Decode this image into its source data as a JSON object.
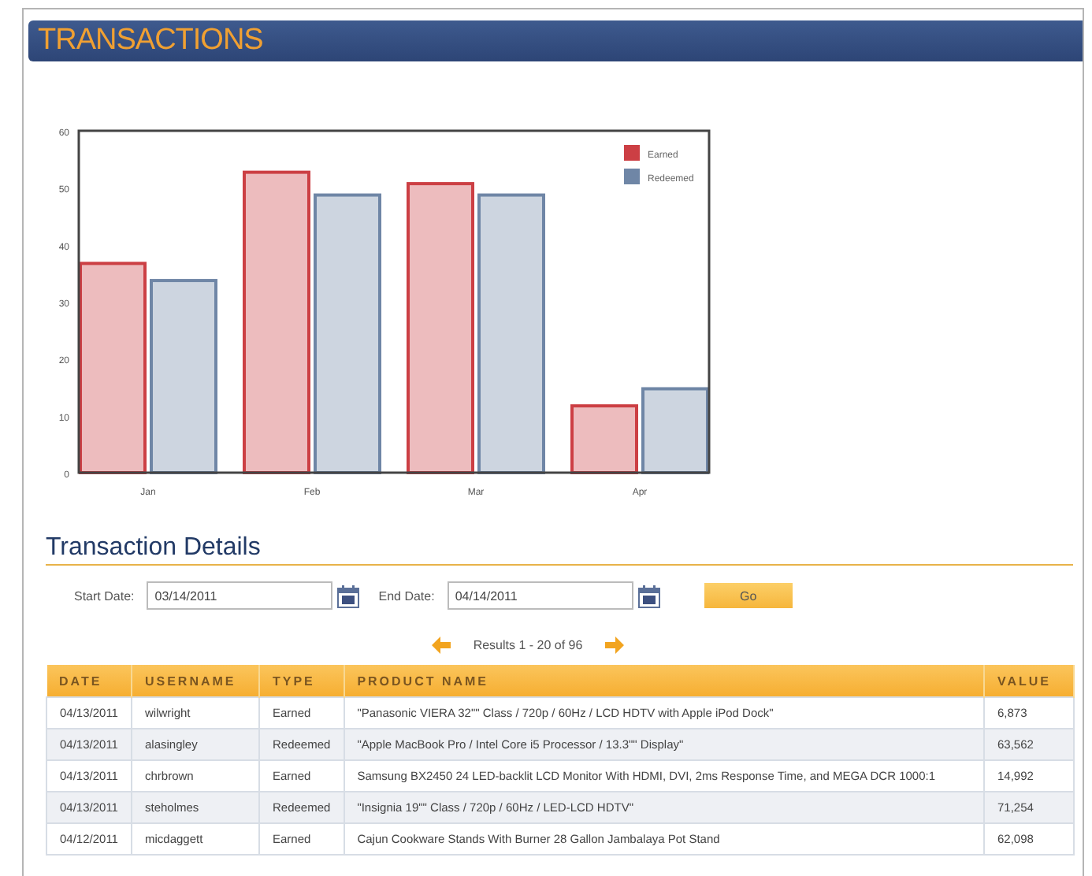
{
  "header": {
    "title": "TRANSACTIONS"
  },
  "chart": {
    "chart_data": {
      "type": "bar",
      "legend": true,
      "categories": [
        "Jan",
        "Feb",
        "Mar",
        "Apr"
      ],
      "ylim": [
        0,
        60
      ],
      "yticks": [
        0,
        10,
        20,
        30,
        40,
        50,
        60
      ],
      "series": [
        {
          "name": "Earned",
          "color": "#cc3f44",
          "values": [
            37,
            53,
            51,
            12
          ]
        },
        {
          "name": "Redeemed",
          "color": "#6f86a6",
          "values": [
            34,
            49,
            49,
            15
          ]
        }
      ]
    }
  },
  "details": {
    "title": "Transaction Details",
    "filters": [
      {
        "label": "Start Date:",
        "value": "03/14/2011"
      },
      {
        "label": "End Date:",
        "value": "04/14/2011"
      }
    ],
    "go_button": "Go",
    "pager": {
      "text": "Results 1 - 20 of 96"
    },
    "table": {
      "columns": [
        "DATE",
        "USERNAME",
        "TYPE",
        "PRODUCT NAME",
        "VALUE"
      ],
      "rows": [
        [
          "04/13/2011",
          "wilwright",
          "Earned",
          "\"Panasonic VIERA 32\"\" Class / 720p / 60Hz / LCD HDTV with Apple iPod Dock\"",
          "6,873"
        ],
        [
          "04/13/2011",
          "alasingley",
          "Redeemed",
          "\"Apple MacBook Pro / Intel Core i5 Processor / 13.3\"\" Display\"",
          "63,562"
        ],
        [
          "04/13/2011",
          "chrbrown",
          "Earned",
          "Samsung BX2450 24 LED-backlit LCD Monitor With HDMI, DVI, 2ms Response Time, and MEGA DCR 1000:1",
          "14,992"
        ],
        [
          "04/13/2011",
          "steholmes",
          "Redeemed",
          "\"Insignia 19\"\" Class / 720p / 60Hz / LED-LCD HDTV\"",
          "71,254"
        ],
        [
          "04/12/2011",
          "micdaggett",
          "Earned",
          "Cajun Cookware Stands With Burner 28 Gallon Jambalaya Pot Stand",
          "62,098"
        ]
      ]
    }
  }
}
